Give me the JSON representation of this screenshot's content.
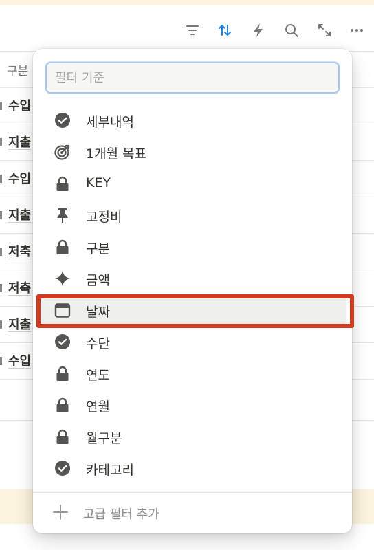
{
  "toolbar": {
    "icons": [
      "filter-icon",
      "sort-icon",
      "automation-icon",
      "search-icon",
      "expand-icon",
      "more-icon"
    ],
    "accent": "#2383e2"
  },
  "table": {
    "header": "구분",
    "rows": [
      "수입",
      "지출",
      "수입",
      "지출",
      "저축",
      "저축",
      "지출",
      "수입"
    ]
  },
  "filter_menu": {
    "search_placeholder": "필터 기준",
    "items": [
      {
        "label": "세부내역",
        "icon": "check-circle-icon"
      },
      {
        "label": "1개월 목표",
        "icon": "target-icon"
      },
      {
        "label": "KEY",
        "icon": "lock-icon"
      },
      {
        "label": "고정비",
        "icon": "pin-icon"
      },
      {
        "label": "구분",
        "icon": "lock-icon"
      },
      {
        "label": "금액",
        "icon": "sparkle-icon"
      },
      {
        "label": "날짜",
        "icon": "calendar-icon"
      },
      {
        "label": "수단",
        "icon": "check-circle-icon"
      },
      {
        "label": "연도",
        "icon": "lock-icon"
      },
      {
        "label": "연월",
        "icon": "lock-icon"
      },
      {
        "label": "월구분",
        "icon": "lock-icon"
      },
      {
        "label": "카테고리",
        "icon": "check-circle-icon"
      }
    ],
    "add_advanced_filter": "고급 필터 추가",
    "selected_label": "날짜",
    "highlight_color": "#d33a22"
  }
}
